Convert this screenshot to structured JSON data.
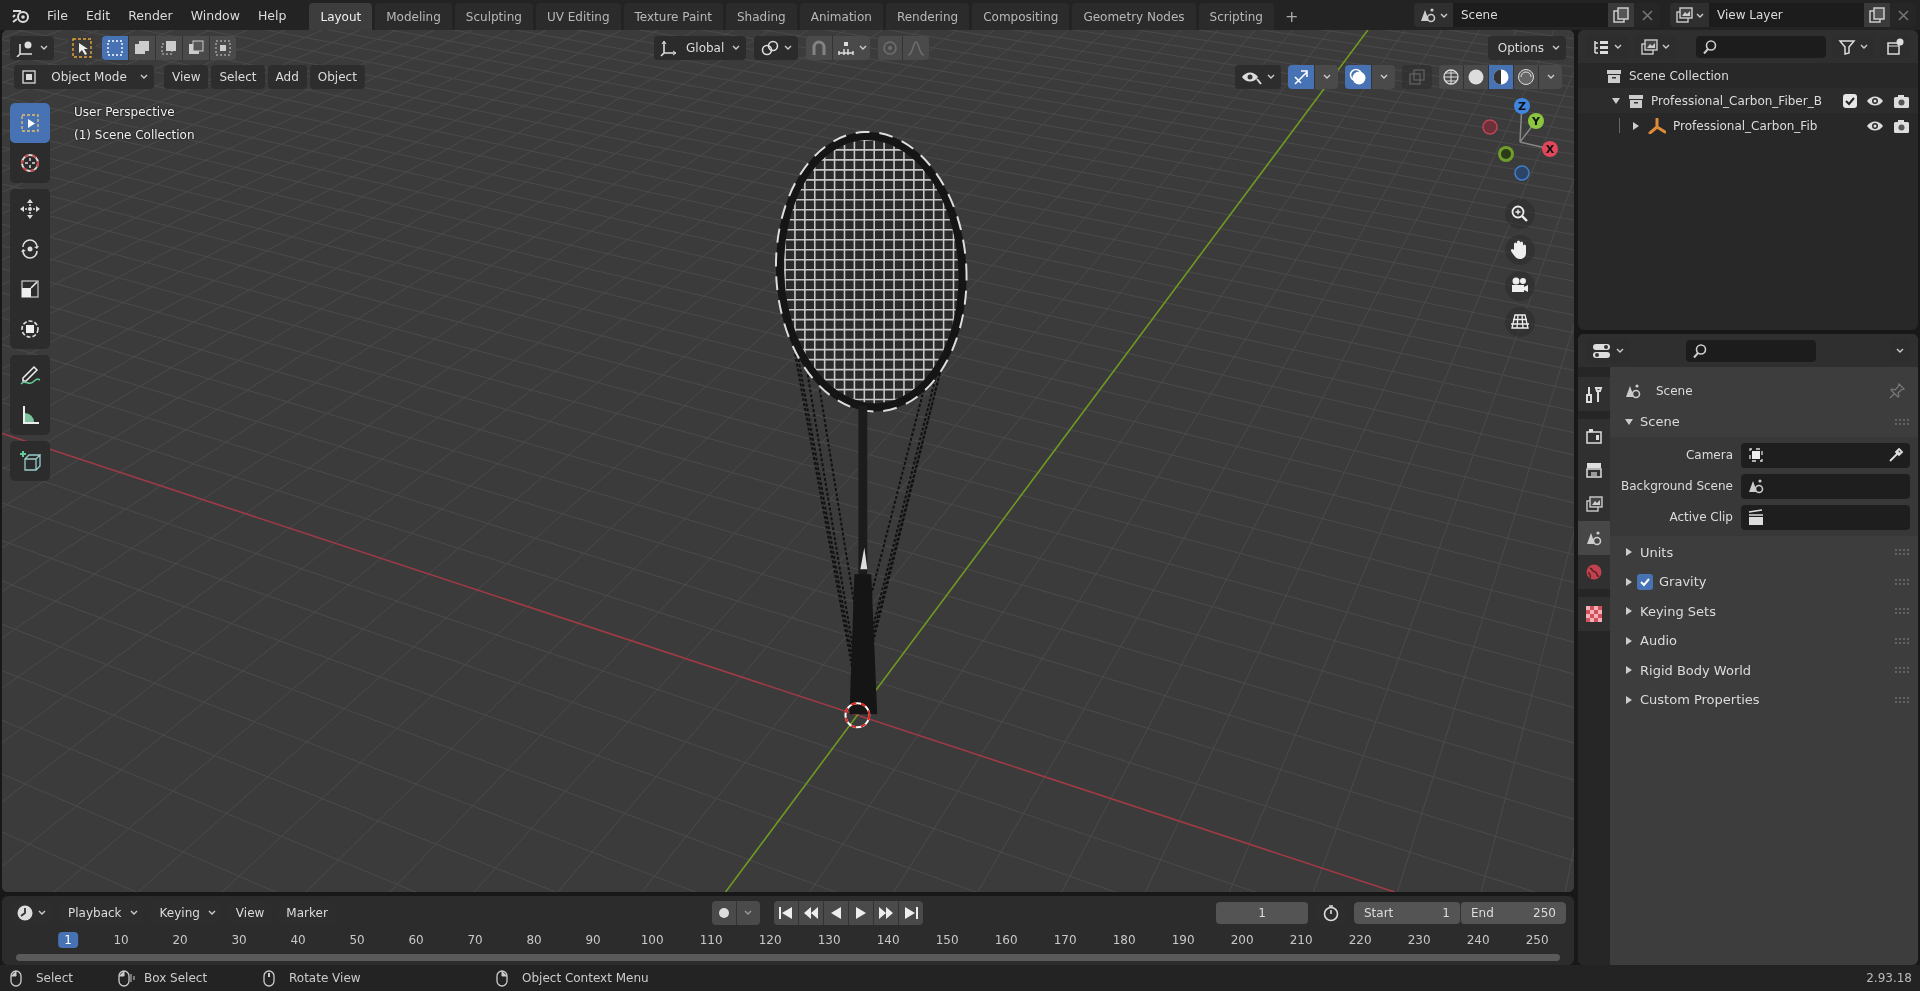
{
  "top_menu": [
    "File",
    "Edit",
    "Render",
    "Window",
    "Help"
  ],
  "workspaces": [
    {
      "label": "Layout",
      "selected": true
    },
    {
      "label": "Modeling",
      "selected": false
    },
    {
      "label": "Sculpting",
      "selected": false
    },
    {
      "label": "UV Editing",
      "selected": false
    },
    {
      "label": "Texture Paint",
      "selected": false
    },
    {
      "label": "Shading",
      "selected": false
    },
    {
      "label": "Animation",
      "selected": false
    },
    {
      "label": "Rendering",
      "selected": false
    },
    {
      "label": "Compositing",
      "selected": false
    },
    {
      "label": "Geometry Nodes",
      "selected": false
    },
    {
      "label": "Scripting",
      "selected": false
    }
  ],
  "add_workspace": "+",
  "scene": "Scene",
  "view_layer": "View Layer",
  "viewport": {
    "select_modes": [
      {
        "selected": true
      },
      {
        "selected": false
      },
      {
        "selected": false
      },
      {
        "selected": false
      },
      {
        "selected": false
      }
    ],
    "transform_orientation": "Global",
    "options": "Options",
    "mode": "Object Mode",
    "menus": [
      "View",
      "Select",
      "Add",
      "Object"
    ],
    "gizmos_on": true,
    "overlays_on": true,
    "shading_modes": [
      {
        "selected": false
      },
      {
        "selected": false
      },
      {
        "selected": true
      },
      {
        "selected": false
      }
    ],
    "overlay_text": [
      "User Perspective",
      "(1) Scene Collection"
    ],
    "tools": [
      {
        "kind": "select",
        "selected": true
      },
      {
        "kind": "cursor",
        "selected": false
      },
      {
        "kind": "move",
        "selected": false
      },
      {
        "kind": "rotate",
        "selected": false
      },
      {
        "kind": "scale",
        "selected": false
      },
      {
        "kind": "transform",
        "selected": false
      },
      {
        "kind": "annotate",
        "selected": false
      },
      {
        "kind": "measure",
        "selected": false
      },
      {
        "kind": "add_cube",
        "selected": false
      }
    ],
    "gizmo_axes": [
      "X",
      "Y",
      "Z"
    ]
  },
  "outliner": {
    "root": "Scene Collection",
    "items": [
      {
        "name": "Professional_Carbon_Fiber_B",
        "expanded": true,
        "checked": true,
        "children": [
          {
            "name": "Professional_Carbon_Fib",
            "expanded": false
          }
        ]
      }
    ]
  },
  "properties": {
    "tabs": [
      {
        "kind": "tool",
        "selected": false
      },
      {
        "kind": "render",
        "selected": false
      },
      {
        "kind": "output",
        "selected": false
      },
      {
        "kind": "view_layer",
        "selected": false
      },
      {
        "kind": "scene",
        "selected": true
      },
      {
        "kind": "world",
        "selected": false
      },
      {
        "kind": "texture",
        "selected": false
      }
    ],
    "context": "Scene",
    "panels": [
      {
        "title": "Scene",
        "expanded": true,
        "fields": [
          {
            "label": "Camera",
            "kind": "object"
          },
          {
            "label": "Background Scene",
            "kind": "scene"
          },
          {
            "label": "Active Clip",
            "kind": "clip"
          }
        ]
      },
      {
        "title": "Units",
        "expanded": false
      },
      {
        "title": "Gravity",
        "expanded": false,
        "checked": true
      },
      {
        "title": "Keying Sets",
        "expanded": false
      },
      {
        "title": "Audio",
        "expanded": false
      },
      {
        "title": "Rigid Body World",
        "expanded": false
      },
      {
        "title": "Custom Properties",
        "expanded": false
      }
    ]
  },
  "timeline": {
    "menus": [
      "Playback",
      "Keying",
      "View",
      "Marker"
    ],
    "current_frame": "1",
    "start_label": "Start",
    "start": "1",
    "end_label": "End",
    "end": "250",
    "ruler": [
      {
        "label": "1",
        "selected": true
      },
      {
        "label": "10",
        "selected": false
      },
      {
        "label": "20",
        "selected": false
      },
      {
        "label": "30",
        "selected": false
      },
      {
        "label": "40",
        "selected": false
      },
      {
        "label": "50",
        "selected": false
      },
      {
        "label": "60",
        "selected": false
      },
      {
        "label": "70",
        "selected": false
      },
      {
        "label": "80",
        "selected": false
      },
      {
        "label": "90",
        "selected": false
      },
      {
        "label": "100",
        "selected": false
      },
      {
        "label": "110",
        "selected": false
      },
      {
        "label": "120",
        "selected": false
      },
      {
        "label": "130",
        "selected": false
      },
      {
        "label": "140",
        "selected": false
      },
      {
        "label": "150",
        "selected": false
      },
      {
        "label": "160",
        "selected": false
      },
      {
        "label": "170",
        "selected": false
      },
      {
        "label": "180",
        "selected": false
      },
      {
        "label": "190",
        "selected": false
      },
      {
        "label": "200",
        "selected": false
      },
      {
        "label": "210",
        "selected": false
      },
      {
        "label": "220",
        "selected": false
      },
      {
        "label": "230",
        "selected": false
      },
      {
        "label": "240",
        "selected": false
      },
      {
        "label": "250",
        "selected": false
      }
    ]
  },
  "status_bar": {
    "hints": [
      "Select",
      "Box Select",
      "Rotate View",
      "Object Context Menu"
    ],
    "version": "2.93.18"
  }
}
